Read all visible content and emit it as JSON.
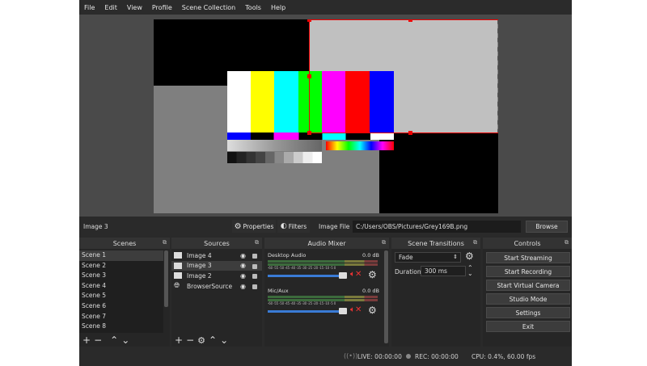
{
  "menu": [
    "File",
    "Edit",
    "View",
    "Profile",
    "Scene Collection",
    "Tools",
    "Help"
  ],
  "properties_bar": {
    "selected_source": "Image 3",
    "properties_label": "Properties",
    "filters_label": "Filters",
    "image_file_label": "Image File",
    "file_path": "C:/Users/OBS/Pictures/Grey169B.png",
    "browse_label": "Browse"
  },
  "scenes": {
    "title": "Scenes",
    "items": [
      "Scene 1",
      "Scene 2",
      "Scene 3",
      "Scene 4",
      "Scene 5",
      "Scene 6",
      "Scene 7",
      "Scene 8"
    ]
  },
  "sources": {
    "title": "Sources",
    "items": [
      "Image 4",
      "Image 3",
      "Image 2",
      "BrowserSource"
    ]
  },
  "audio": {
    "title": "Audio Mixer",
    "tracks": [
      {
        "name": "Desktop Audio",
        "level": "0.0 dB"
      },
      {
        "name": "Mic/Aux",
        "level": "0.0 dB"
      }
    ],
    "scale": "-60 -55 -50 -45 -40 -35 -30 -25 -20 -15 -10 -5 0"
  },
  "transitions": {
    "title": "Scene Transitions",
    "selected": "Fade",
    "duration_label": "Duration",
    "duration_value": "300 ms"
  },
  "controls": {
    "title": "Controls",
    "buttons": [
      "Start Streaming",
      "Start Recording",
      "Start Virtual Camera",
      "Studio Mode",
      "Settings",
      "Exit"
    ]
  },
  "status": {
    "live": "LIVE: 00:00:00",
    "rec": "REC: 00:00:00",
    "cpu": "CPU: 0.4%, 60.00 fps"
  },
  "colors": {
    "bars": [
      "#ffffff",
      "#ffff00",
      "#00ffff",
      "#00ff00",
      "#ff00ff",
      "#ff0000",
      "#0000ff"
    ],
    "selection": "#e00000"
  }
}
